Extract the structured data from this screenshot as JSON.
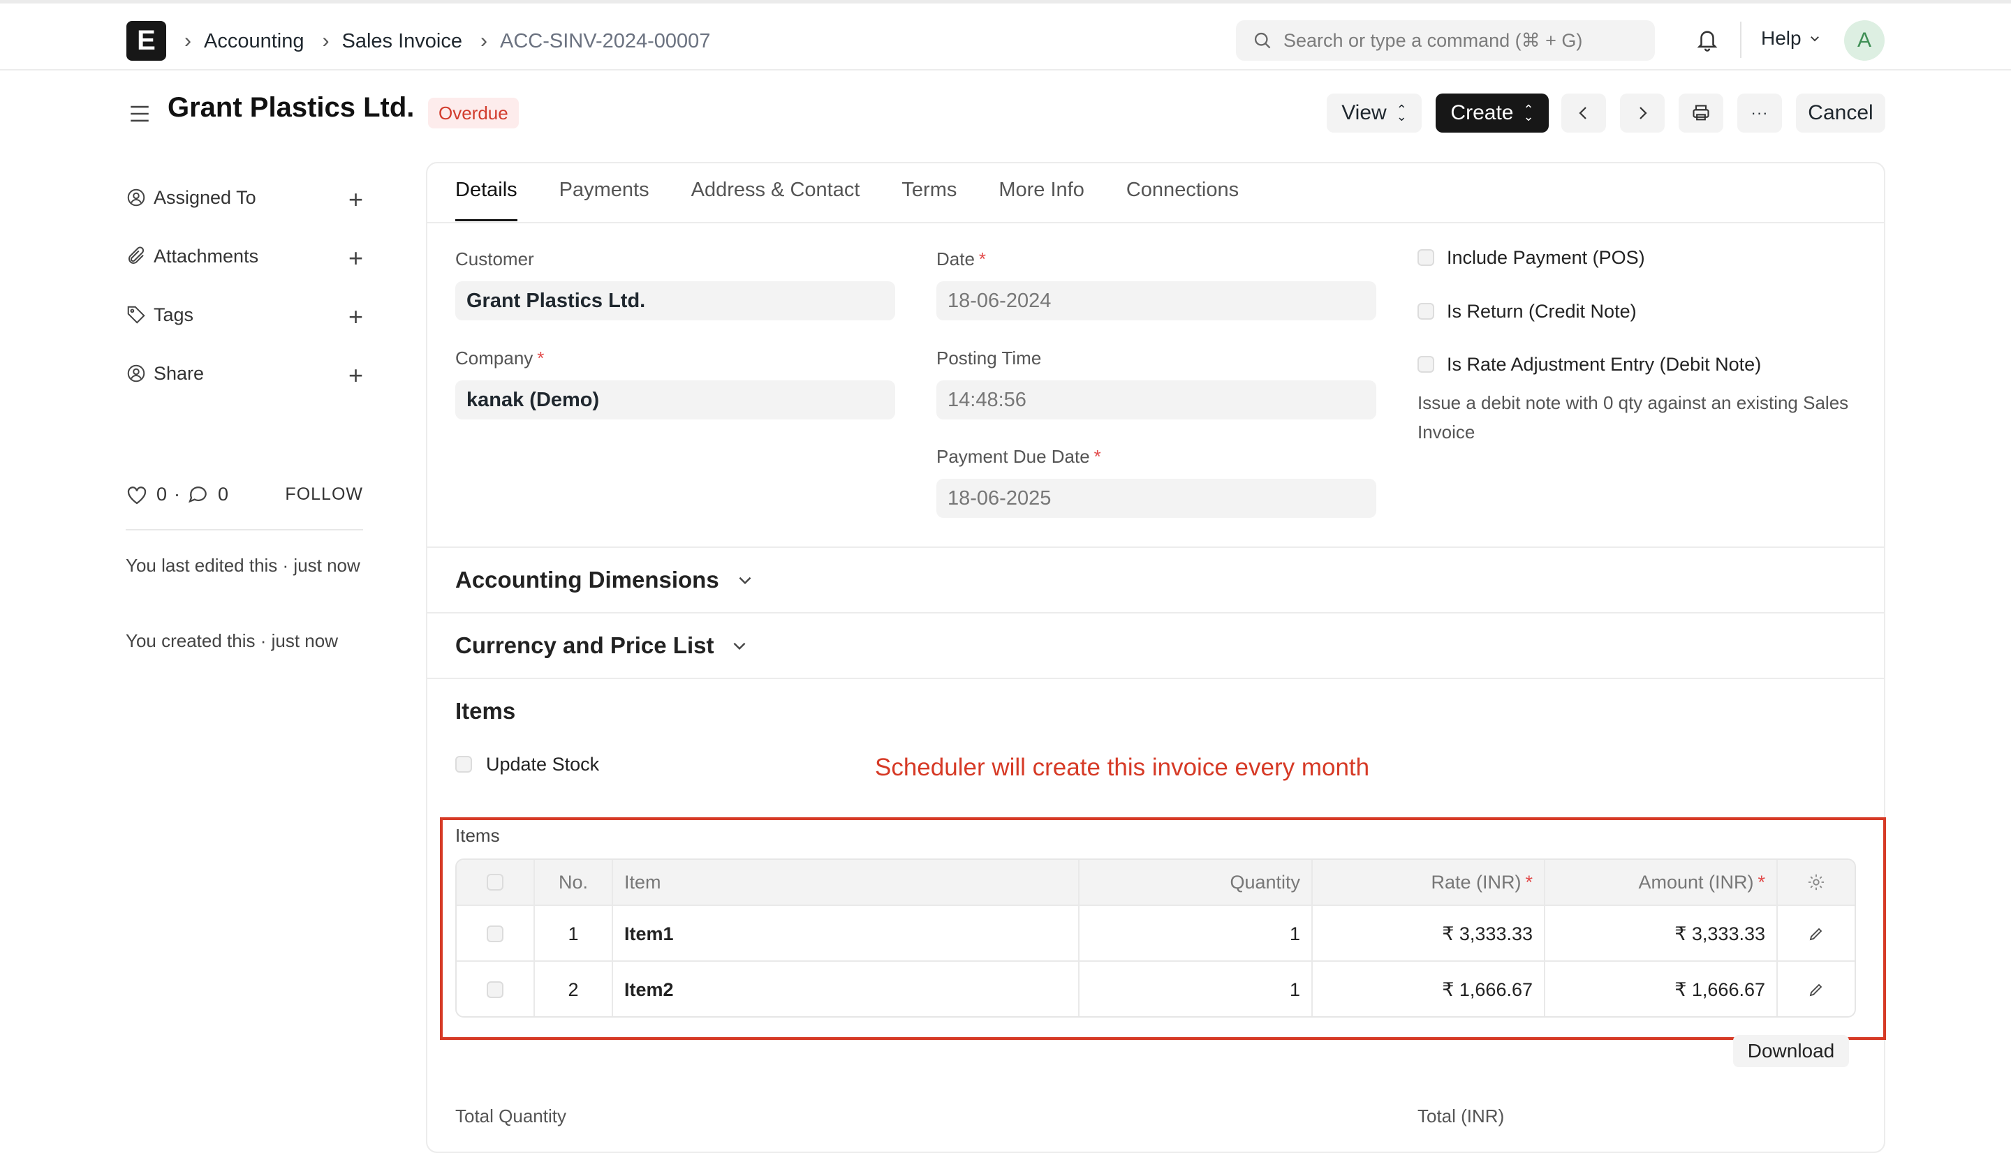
{
  "navbar": {
    "logo_letter": "E",
    "breadcrumbs": [
      "Accounting",
      "Sales Invoice",
      "ACC-SINV-2024-00007"
    ],
    "search_placeholder": "Search or type a command (⌘ + G)",
    "help_label": "Help",
    "avatar_initial": "A"
  },
  "header": {
    "title": "Grant Plastics Ltd.",
    "status": "Overdue",
    "view_label": "View",
    "create_label": "Create",
    "cancel_label": "Cancel",
    "more_label": "···"
  },
  "sidebar": {
    "items": [
      {
        "label": "Assigned To",
        "icon": "assign-user-icon"
      },
      {
        "label": "Attachments",
        "icon": "paperclip-icon"
      },
      {
        "label": "Tags",
        "icon": "tag-icon"
      },
      {
        "label": "Share",
        "icon": "share-user-icon"
      }
    ],
    "likes_count": "0",
    "comments_count": "0",
    "dot": "·",
    "follow_label": "FOLLOW",
    "activity": [
      "You last edited this · just now",
      "You created this · just now"
    ]
  },
  "tabs": [
    "Details",
    "Payments",
    "Address & Contact",
    "Terms",
    "More Info",
    "Connections"
  ],
  "details": {
    "customer_label": "Customer",
    "customer_value": "Grant Plastics Ltd.",
    "company_label": "Company",
    "company_value": "kanak (Demo)",
    "date_label": "Date",
    "date_value": "18-06-2024",
    "posting_time_label": "Posting Time",
    "posting_time_value": "14:48:56",
    "due_date_label": "Payment Due Date",
    "due_date_value": "18-06-2025",
    "required_mark": "*",
    "checks": [
      "Include Payment (POS)",
      "Is Return (Credit Note)",
      "Is Rate Adjustment Entry (Debit Note)"
    ],
    "debit_note_desc": "Issue a debit note with 0 qty against an existing Sales Invoice"
  },
  "sections": {
    "accounting_dimensions": "Accounting Dimensions",
    "currency_price_list": "Currency and Price List",
    "items": "Items"
  },
  "items": {
    "update_stock_label": "Update Stock",
    "annotation": "Scheduler will create this invoice every month",
    "grid_label": "Items",
    "columns": {
      "no": "No.",
      "item": "Item",
      "quantity": "Quantity",
      "rate": "Rate (INR)",
      "amount": "Amount (INR)"
    },
    "rows": [
      {
        "no": "1",
        "item": "Item1",
        "quantity": "1",
        "rate": "₹ 3,333.33",
        "amount": "₹ 3,333.33"
      },
      {
        "no": "2",
        "item": "Item2",
        "quantity": "1",
        "rate": "₹ 1,666.67",
        "amount": "₹ 1,666.67"
      }
    ],
    "download_label": "Download"
  },
  "totals": {
    "total_quantity_label": "Total Quantity",
    "total_label": "Total (INR)"
  },
  "colors": {
    "annotation_red": "#d63a26",
    "status_red": "#d23c2d",
    "dark_button": "#171717"
  }
}
